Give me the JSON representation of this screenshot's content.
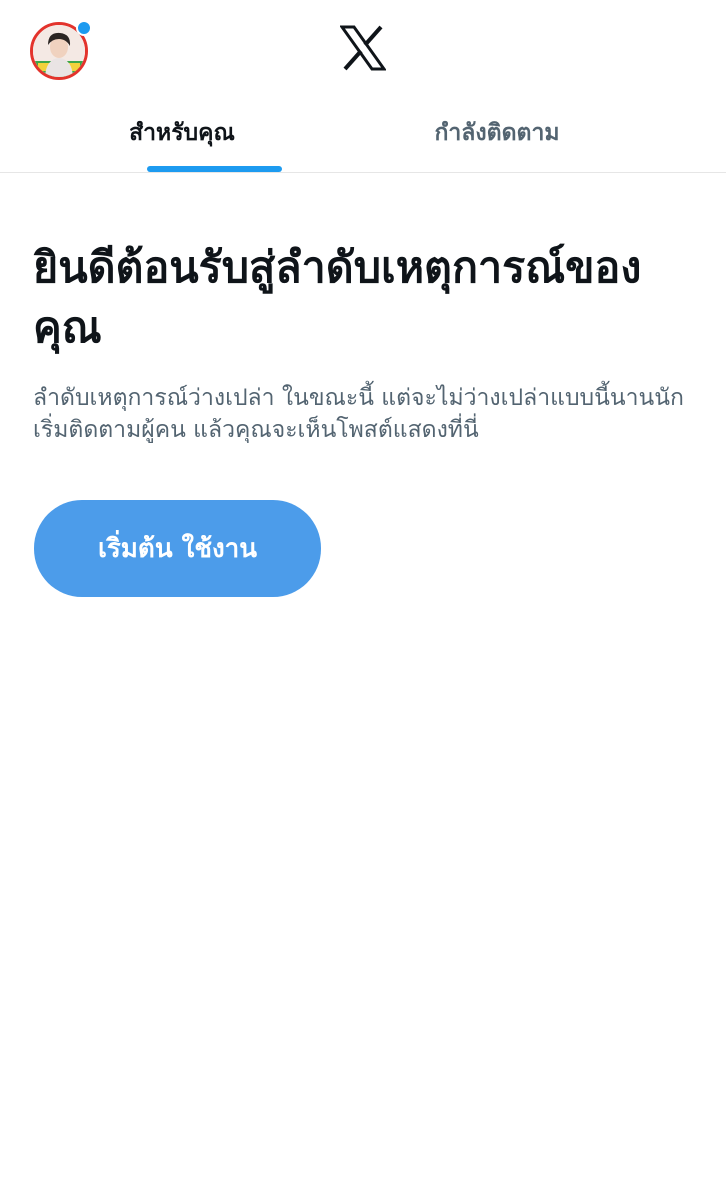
{
  "header": {
    "avatar_icon": "user-avatar-icon",
    "logo_icon": "x-logo-icon",
    "notification_dot_color": "#1d9bf0"
  },
  "tabs": [
    {
      "label": "สำหรับคุณ",
      "active": true
    },
    {
      "label": "กำลังติดตาม",
      "active": false
    }
  ],
  "main": {
    "headline": "ยินดีต้อนรับสู่ลำดับเหตุการณ์ของคุณ",
    "description": "ลำดับเหตุการณ์ว่างเปล่า ในขณะนี้ แต่จะไม่ว่างเปล่าแบบนี้นานนัก เริ่มติดตามผู้คน แล้วคุณจะเห็นโพสต์แสดงที่นี่",
    "cta_label": "เริ่มต้น ใช้งาน"
  },
  "colors": {
    "accent": "#1d9bf0",
    "button": "#4c9cea",
    "text_primary": "#0f1419",
    "text_secondary": "#536471"
  }
}
